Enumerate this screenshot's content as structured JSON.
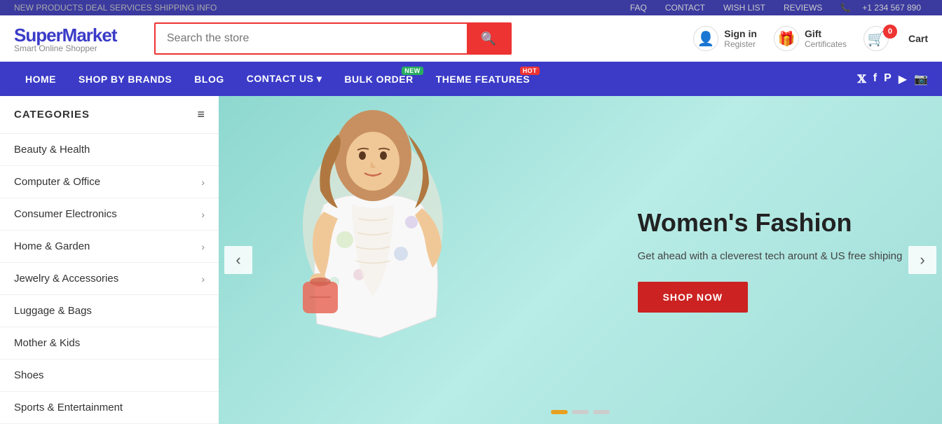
{
  "topbar": {
    "left_text": "NEW PRODUCTS DEAL SERVICES SHIPPING INFO",
    "links": [
      "FAQ",
      "CONTACT",
      "WISH LIST",
      "REVIEWS"
    ],
    "phone": "+1 234 567 890"
  },
  "header": {
    "logo_main": "SuperMarket",
    "logo_sub": "Smart Online Shopper",
    "search_placeholder": "Search the store",
    "actions": {
      "sign_in": "Sign in",
      "register": "Register",
      "gift": "Gift",
      "certificates": "Certificates",
      "cart": "Cart",
      "cart_count": "0"
    }
  },
  "navbar": {
    "items": [
      {
        "label": "HOME",
        "badge": null
      },
      {
        "label": "SHOP BY BRANDS",
        "badge": null
      },
      {
        "label": "BLOG",
        "badge": null
      },
      {
        "label": "CONTACT US",
        "badge": null,
        "dropdown": true
      },
      {
        "label": "BULK ORDER",
        "badge": "NEW"
      },
      {
        "label": "THEME FEATURES",
        "badge": "HOT"
      }
    ],
    "social": [
      "𝕏",
      "f",
      "𝐩",
      "▶",
      "📷"
    ]
  },
  "sidebar": {
    "title": "CATEGORIES",
    "items": [
      {
        "label": "Beauty & Health",
        "has_arrow": false
      },
      {
        "label": "Computer & Office",
        "has_arrow": true
      },
      {
        "label": "Consumer Electronics",
        "has_arrow": true
      },
      {
        "label": "Home & Garden",
        "has_arrow": true
      },
      {
        "label": "Jewelry & Accessories",
        "has_arrow": true
      },
      {
        "label": "Luggage & Bags",
        "has_arrow": false
      },
      {
        "label": "Mother & Kids",
        "has_arrow": false
      },
      {
        "label": "Shoes",
        "has_arrow": false
      },
      {
        "label": "Sports & Entertainment",
        "has_arrow": false
      }
    ]
  },
  "hero": {
    "title": "Women's Fashion",
    "description": "Get ahead with a cleverest tech arount & US free shiping",
    "button_label": "SHOP NOW",
    "dots": [
      {
        "active": true
      },
      {
        "active": false
      },
      {
        "active": false
      }
    ]
  }
}
